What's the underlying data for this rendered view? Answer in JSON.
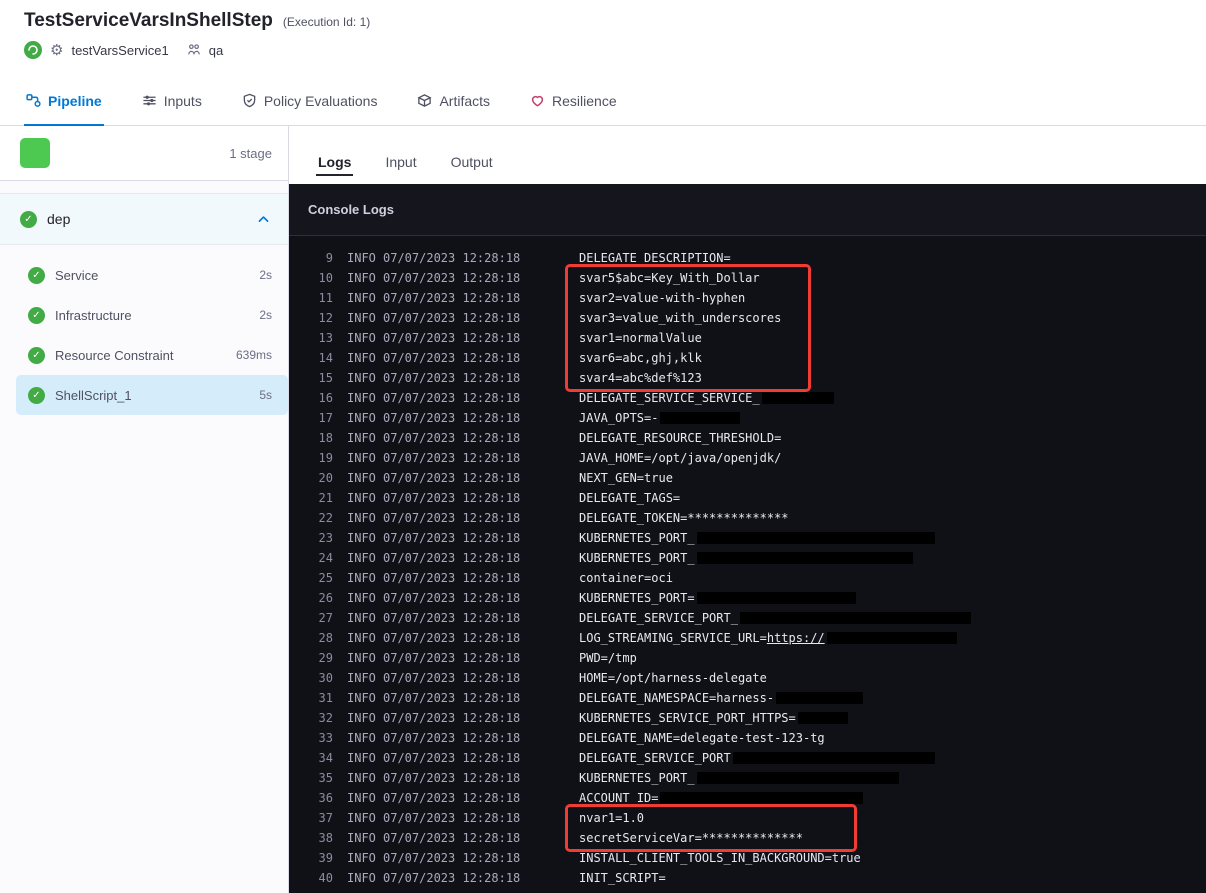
{
  "colors": {
    "accent_blue": "#0278d5",
    "success_green": "#42ab45",
    "highlight_red": "#f13c35"
  },
  "header": {
    "title": "TestServiceVarsInShellStep",
    "execution_id": "(Execution Id: 1)",
    "service_name": "testVarsService1",
    "environment_name": "qa"
  },
  "nav_tabs": [
    {
      "label": "Pipeline",
      "icon": "pipeline-icon",
      "active": true
    },
    {
      "label": "Inputs",
      "icon": "inputs-icon",
      "active": false
    },
    {
      "label": "Policy Evaluations",
      "icon": "policy-evaluations-icon",
      "active": false
    },
    {
      "label": "Artifacts",
      "icon": "artifacts-icon",
      "active": false
    },
    {
      "label": "Resilience",
      "icon": "resilience-icon",
      "active": false
    }
  ],
  "sidebar": {
    "stage_count": "1 stage",
    "stage": {
      "name": "dep",
      "status": "success"
    },
    "steps": [
      {
        "name": "Service",
        "duration": "2s",
        "selected": false
      },
      {
        "name": "Infrastructure",
        "duration": "2s",
        "selected": false
      },
      {
        "name": "Resource Constraint",
        "duration": "639ms",
        "selected": false
      },
      {
        "name": "ShellScript_1",
        "duration": "5s",
        "selected": true
      }
    ]
  },
  "console": {
    "tabs": [
      {
        "label": "Logs",
        "active": true
      },
      {
        "label": "Input",
        "active": false
      },
      {
        "label": "Output",
        "active": false
      }
    ],
    "section_title": "Console Logs",
    "level": "INFO",
    "timestamp": "07/07/2023 12:28:18",
    "lines": [
      {
        "n": 9,
        "m": "DELEGATE_DESCRIPTION="
      },
      {
        "n": 10,
        "m": "svar5$abc=Key_With_Dollar"
      },
      {
        "n": 11,
        "m": "svar2=value-with-hyphen"
      },
      {
        "n": 12,
        "m": "svar3=value_with_underscores"
      },
      {
        "n": 13,
        "m": "svar1=normalValue"
      },
      {
        "n": 14,
        "m": "svar6=abc,ghj,klk"
      },
      {
        "n": 15,
        "m": "svar4=abc%def%123"
      },
      {
        "n": 16,
        "m": "DELEGATE_SERVICE_SERVICE_",
        "r": 10
      },
      {
        "n": 17,
        "m": "JAVA_OPTS=-",
        "r": 11
      },
      {
        "n": 18,
        "m": "DELEGATE_RESOURCE_THRESHOLD="
      },
      {
        "n": 19,
        "m": "JAVA_HOME=/opt/java/openjdk/"
      },
      {
        "n": 20,
        "m": "NEXT_GEN=true"
      },
      {
        "n": 21,
        "m": "DELEGATE_TAGS="
      },
      {
        "n": 22,
        "m": "DELEGATE_TOKEN=**************"
      },
      {
        "n": 23,
        "m": "KUBERNETES_PORT_",
        "r": 33
      },
      {
        "n": 24,
        "m": "KUBERNETES_PORT_",
        "r": 30
      },
      {
        "n": 25,
        "m": "container=oci"
      },
      {
        "n": 26,
        "m": "KUBERNETES_PORT=",
        "r": 22
      },
      {
        "n": 27,
        "m": "DELEGATE_SERVICE_PORT_",
        "r": 32
      },
      {
        "n": 28,
        "m": "LOG_STREAMING_SERVICE_URL=",
        "link": "https://",
        "r": 18
      },
      {
        "n": 29,
        "m": "PWD=/tmp"
      },
      {
        "n": 30,
        "m": "HOME=/opt/harness-delegate"
      },
      {
        "n": 31,
        "m": "DELEGATE_NAMESPACE=harness-",
        "r": 12
      },
      {
        "n": 32,
        "m": "KUBERNETES_SERVICE_PORT_HTTPS=",
        "r": 7
      },
      {
        "n": 33,
        "m": "DELEGATE_NAME=delegate-test-123-tg"
      },
      {
        "n": 34,
        "m": "DELEGATE_SERVICE_PORT",
        "r": 28
      },
      {
        "n": 35,
        "m": "KUBERNETES_PORT_",
        "r": 28
      },
      {
        "n": 36,
        "m": "ACCOUNT_ID=",
        "r": 28
      },
      {
        "n": 37,
        "m": "nvar1=1.0"
      },
      {
        "n": 38,
        "m": "secretServiceVar=**************"
      },
      {
        "n": 39,
        "m": "INSTALL_CLIENT_TOOLS_IN_BACKGROUND=true"
      },
      {
        "n": 40,
        "m": "INIT_SCRIPT="
      }
    ],
    "highlights": [
      {
        "from": 10,
        "to": 15
      },
      {
        "from": 37,
        "to": 38
      }
    ]
  }
}
